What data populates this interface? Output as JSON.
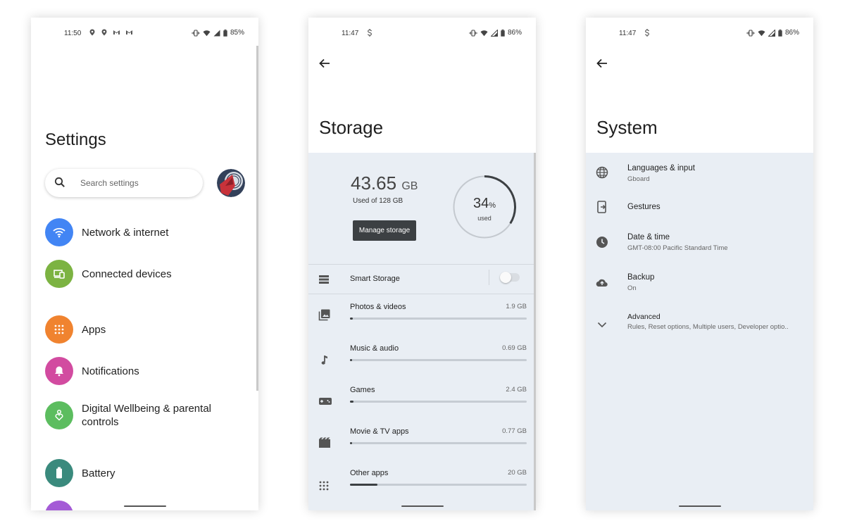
{
  "colors": {
    "network": "#4285f4",
    "connected": "#7cb342",
    "apps": "#f0832f",
    "notifications": "#d24ba0",
    "wellbeing": "#5cbd5f",
    "battery": "#3a8a7d",
    "next_item": "#a45bd6",
    "panel_bg": "#e9eef4",
    "dark_button": "#3c4043"
  },
  "settings_screen": {
    "status": {
      "time": "11:50",
      "battery": "85%"
    },
    "title": "Settings",
    "search_placeholder": "Search settings",
    "items": [
      {
        "label": "Network & internet",
        "icon": "wifi-icon"
      },
      {
        "label": "Connected devices",
        "icon": "devices-icon"
      },
      {
        "label": "Apps",
        "icon": "apps-grid-icon"
      },
      {
        "label": "Notifications",
        "icon": "bell-icon"
      },
      {
        "label": "Digital Wellbeing & parental controls",
        "icon": "wellbeing-icon"
      },
      {
        "label": "Battery",
        "icon": "battery-icon"
      }
    ]
  },
  "storage_screen": {
    "status": {
      "time": "11:47",
      "battery": "86%"
    },
    "title": "Storage",
    "used_value": "43.65",
    "used_unit": "GB",
    "used_of": "Used of 128 GB",
    "manage_button": "Manage storage",
    "percent_value": "34",
    "percent_sign": "%",
    "percent_caption": "used",
    "percent_used": 0.34,
    "smart_storage_label": "Smart Storage",
    "smart_storage_on": false,
    "categories": [
      {
        "name": "Photos & videos",
        "size": "1.9 GB",
        "fraction": 0.015,
        "icon": "photos-icon"
      },
      {
        "name": "Music & audio",
        "size": "0.69 GB",
        "fraction": 0.005,
        "icon": "music-note-icon"
      },
      {
        "name": "Games",
        "size": "2.4 GB",
        "fraction": 0.019,
        "icon": "gamepad-icon"
      },
      {
        "name": "Movie & TV apps",
        "size": "0.77 GB",
        "fraction": 0.006,
        "icon": "movie-icon"
      },
      {
        "name": "Other apps",
        "size": "20 GB",
        "fraction": 0.156,
        "icon": "apps-grid-icon"
      }
    ]
  },
  "system_screen": {
    "status": {
      "time": "11:47",
      "battery": "86%"
    },
    "title": "System",
    "items": [
      {
        "title": "Languages & input",
        "subtitle": "Gboard",
        "icon": "globe-icon"
      },
      {
        "title": "Gestures",
        "subtitle": "",
        "icon": "gestures-phone-icon"
      },
      {
        "title": "Date & time",
        "subtitle": "GMT-08:00 Pacific Standard Time",
        "icon": "clock-icon"
      },
      {
        "title": "Backup",
        "subtitle": "On",
        "icon": "cloud-upload-icon"
      },
      {
        "title": "Advanced",
        "subtitle": "Rules, Reset options, Multiple users, Developer optio..",
        "icon": "chevron-down-icon"
      }
    ]
  }
}
